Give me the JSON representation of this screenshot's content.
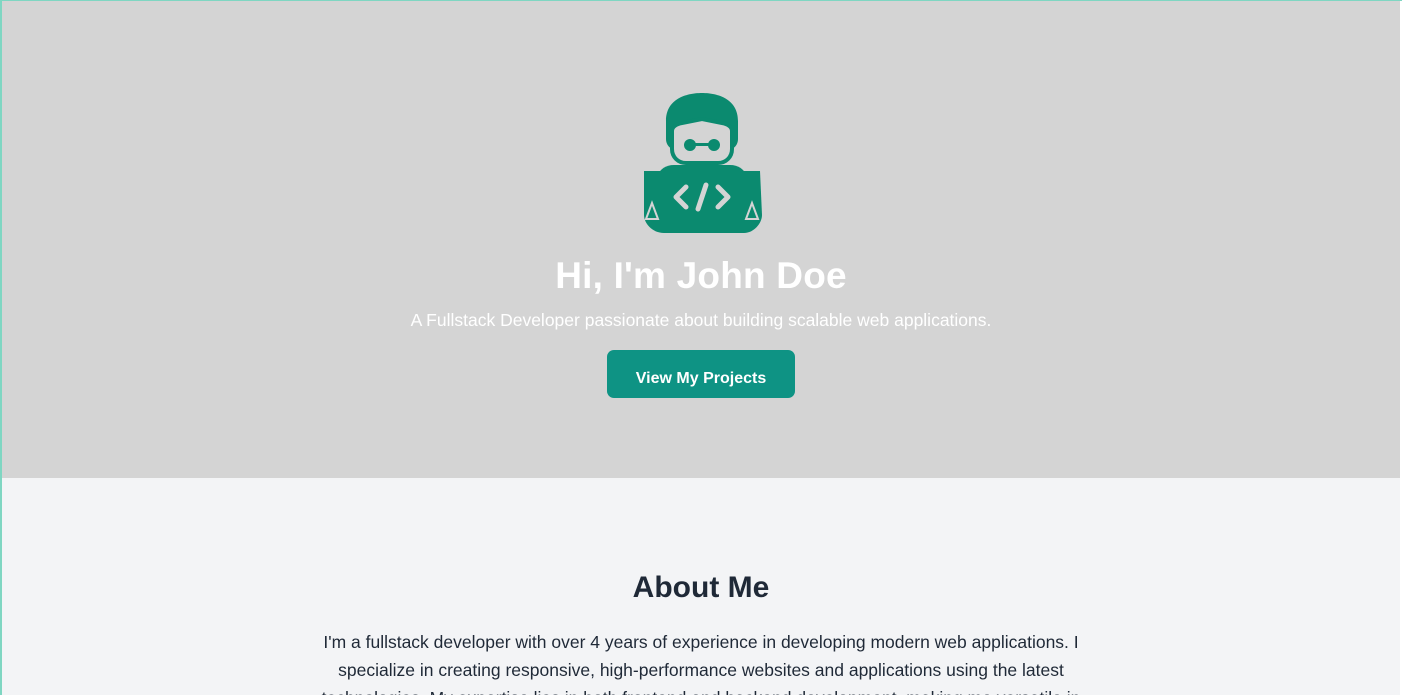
{
  "hero": {
    "avatar_icon": "developer-coding-icon",
    "title": "Hi, I'm John Doe",
    "subtitle": "A Fullstack Developer passionate about building scalable web applications.",
    "cta_label": "View My Projects"
  },
  "about": {
    "title": "About Me",
    "text": "I'm a fullstack developer with over 4 years of experience in developing modern web applications. I specialize in creating responsive, high-performance websites and applications using the latest technologies. My expertise lies in both frontend and backend development, making me versatile in"
  },
  "colors": {
    "accent": "#0e9384",
    "icon": "#0b8a6f",
    "hero_bg": "#d4d4d4",
    "about_bg": "#f3f4f6",
    "heading": "#1f2937"
  }
}
